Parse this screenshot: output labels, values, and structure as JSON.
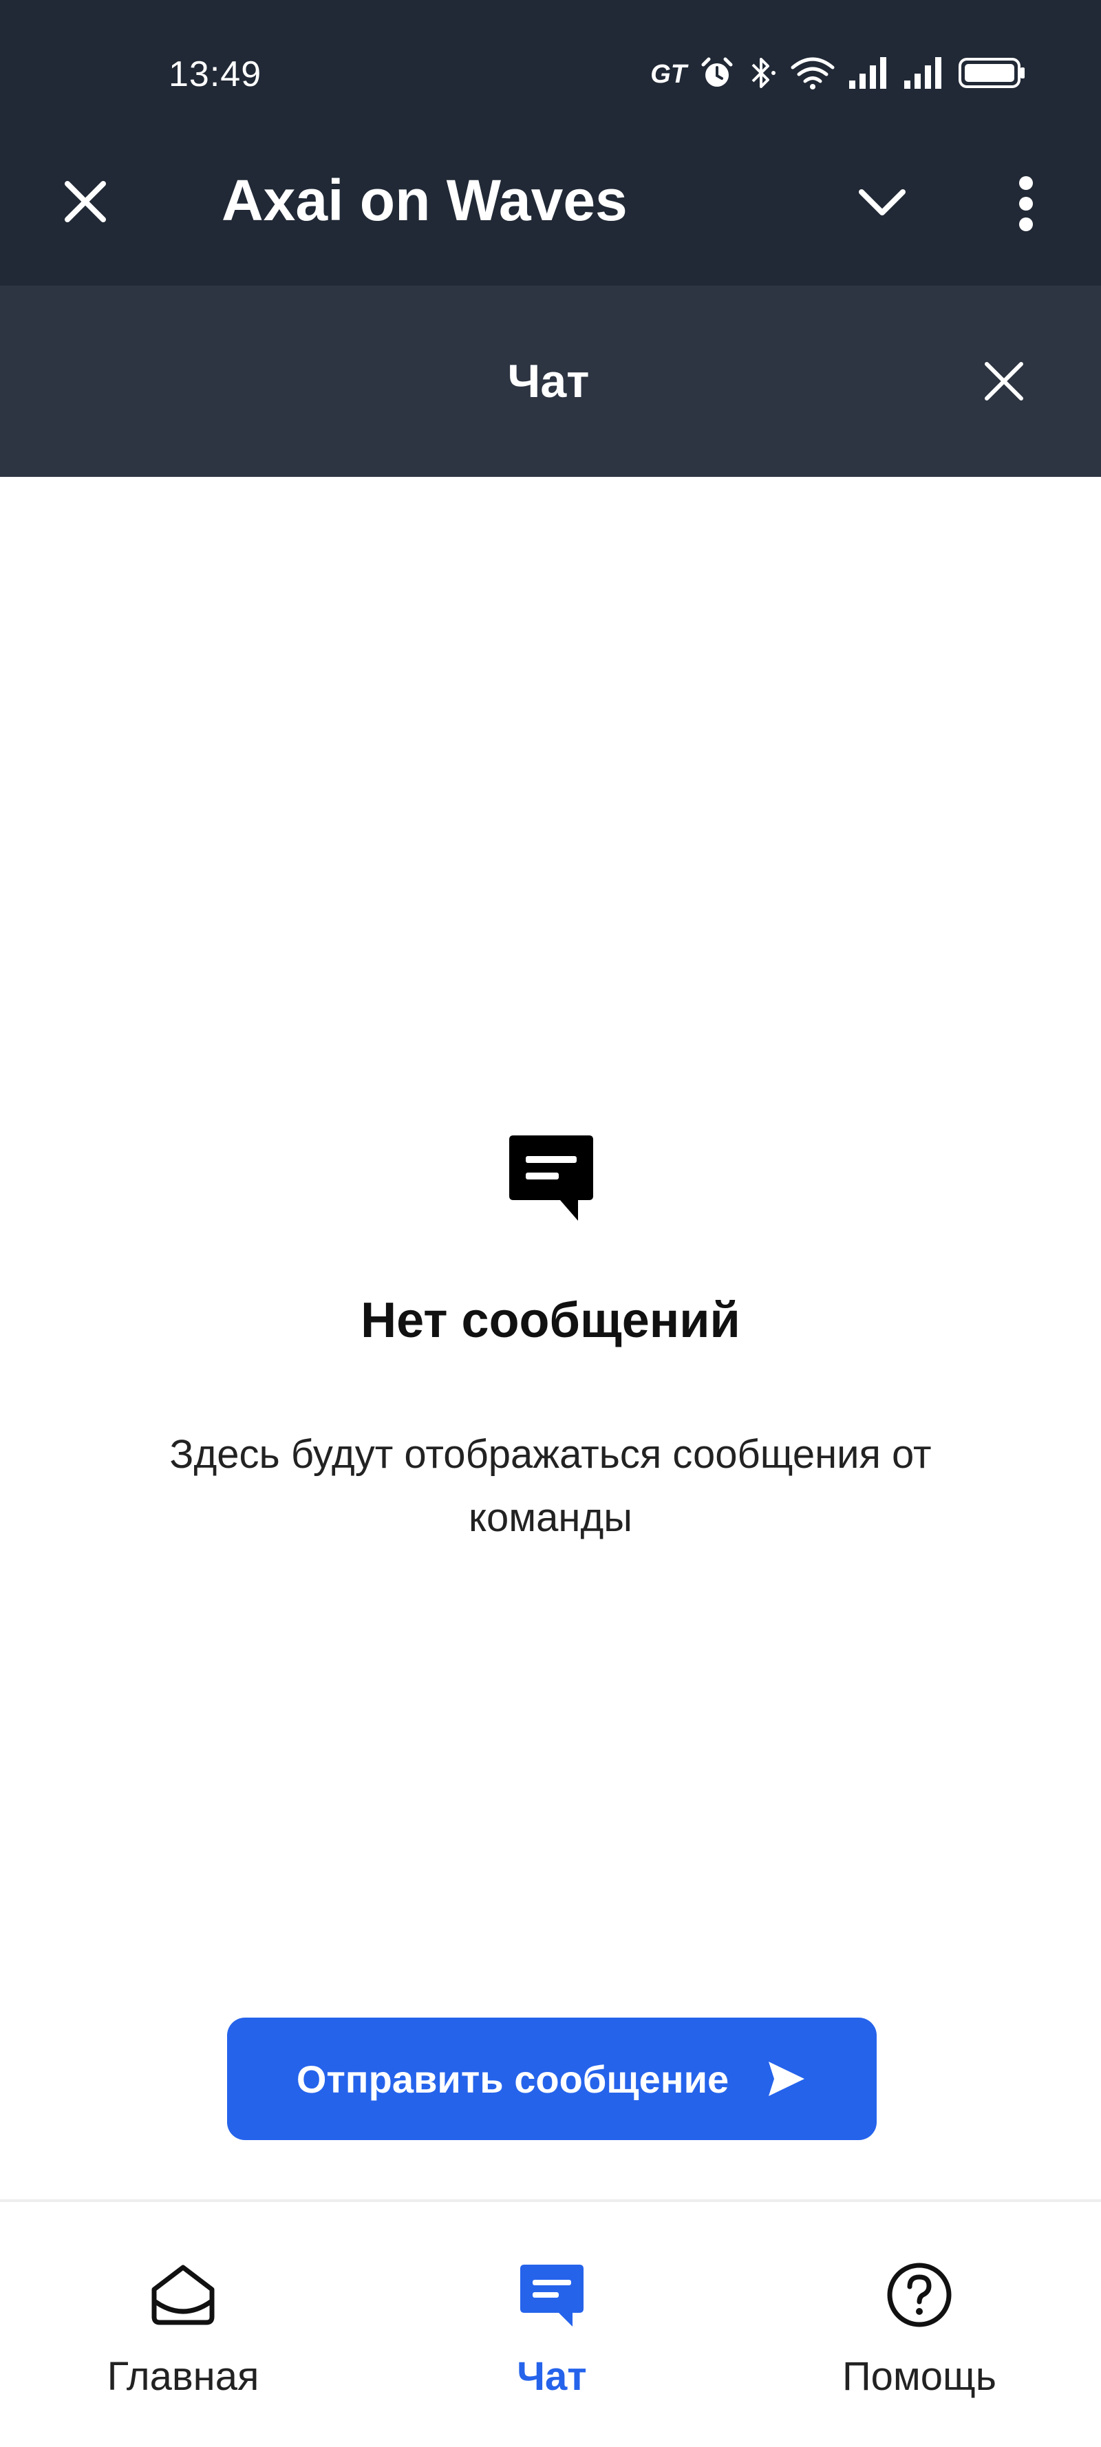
{
  "status_bar": {
    "time": "13:49",
    "network_label": "GT",
    "icons": [
      "alarm-icon",
      "bluetooth-icon",
      "wifi-icon",
      "signal-icon",
      "signal-icon",
      "battery-icon"
    ]
  },
  "header": {
    "title": "Axai on Waves",
    "close_icon": "close-icon",
    "collapse_icon": "chevron-down-icon",
    "more_icon": "more-vertical-icon"
  },
  "panel": {
    "title": "Чат",
    "close_icon": "close-icon"
  },
  "empty_state": {
    "icon": "message-icon",
    "title": "Нет сообщений",
    "description": "Здесь будут отображаться сообщения от команды"
  },
  "send_button": {
    "label": "Отправить сообщение",
    "icon": "send-icon"
  },
  "bottom_nav": {
    "items": [
      {
        "label": "Главная",
        "icon": "home-icon",
        "active": false
      },
      {
        "label": "Чат",
        "icon": "chat-icon",
        "active": true
      },
      {
        "label": "Помощь",
        "icon": "help-icon",
        "active": false
      }
    ]
  },
  "colors": {
    "header_bg": "#212936",
    "panel_bg": "#2d3442",
    "accent": "#2563eb",
    "text_dark": "#111111"
  }
}
